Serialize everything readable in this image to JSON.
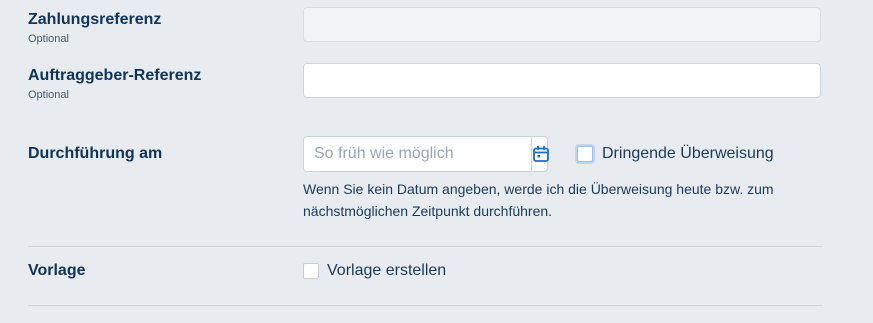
{
  "payment_reference": {
    "label": "Zahlungsreferenz",
    "optional": "Optional",
    "value": ""
  },
  "client_reference": {
    "label": "Auftraggeber-Referenz",
    "optional": "Optional",
    "value": ""
  },
  "execution": {
    "label": "Durchführung am",
    "date_placeholder": "So früh wie möglich",
    "urgent_label": "Dringende Überweisung",
    "urgent_checked": false,
    "hint": "Wenn Sie kein Datum angeben, werde ich die Überweisung heute bzw. zum nächstmöglichen Zeitpunkt durchführen."
  },
  "template": {
    "label": "Vorlage",
    "create_label": "Vorlage erstellen",
    "create_checked": false
  },
  "colors": {
    "accent": "#1a6fc4",
    "label": "#0f3457",
    "background": "#e8ecf0"
  }
}
